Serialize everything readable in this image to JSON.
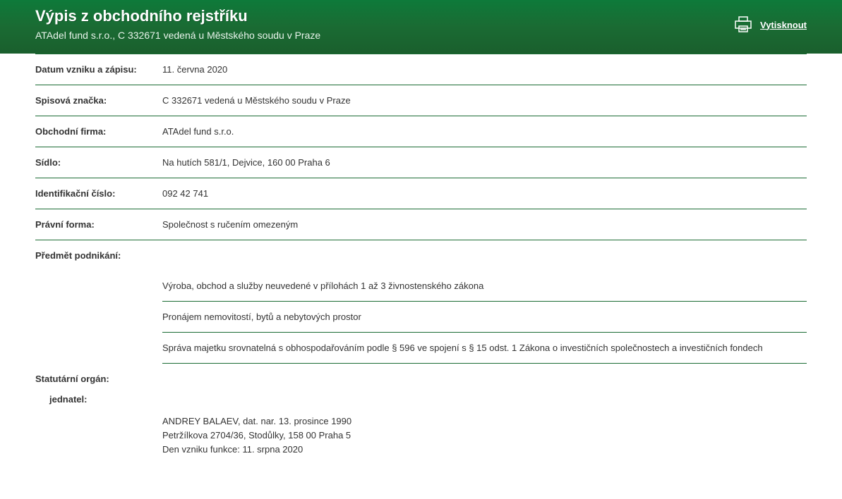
{
  "header": {
    "title": "Výpis z obchodního rejstříku",
    "subtitle": "ATAdel fund s.r.o., C 332671 vedená u Městského soudu v Praze",
    "print_label": "Vytisknout"
  },
  "rows": {
    "datum_label": "Datum vzniku a zápisu:",
    "datum_value": "11. června 2020",
    "spisova_label": "Spisová značka:",
    "spisova_value": "C 332671 vedená u Městského soudu v Praze",
    "firma_label": "Obchodní firma:",
    "firma_value": "ATAdel fund s.r.o.",
    "sidlo_label": "Sídlo:",
    "sidlo_value": "Na hutích 581/1, Dejvice, 160 00 Praha 6",
    "ic_label": "Identifikační číslo:",
    "ic_value": "092 42 741",
    "forma_label": "Právní forma:",
    "forma_value": "Společnost s ručením omezeným",
    "predmet_label": "Předmět podnikání:"
  },
  "predmet_items": {
    "0": "Výroba, obchod a služby neuvedené v přílohách 1 až 3 živnostenského zákona",
    "1": "Pronájem nemovitostí, bytů a nebytových prostor",
    "2": "Správa majetku srovnatelná s obhospodařováním podle § 596 ve spojení s § 15 odst. 1 Zákona o investičních společnostech a investičních fondech"
  },
  "statutarni": {
    "label": "Statutární orgán:",
    "sub_label": "jednatel:",
    "person_line1": "ANDREY BALAEV, dat. nar. 13. prosince 1990",
    "person_line2": "Petržílkova 2704/36, Stodůlky, 158 00 Praha 5",
    "person_line3": "Den vzniku funkce: 11. srpna 2020"
  }
}
